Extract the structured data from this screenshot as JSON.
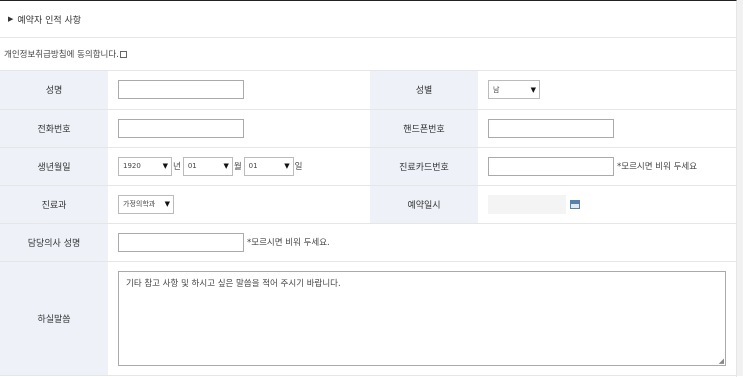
{
  "section": {
    "title": "예약자 인적 사항"
  },
  "consent": {
    "text": "개인정보취급방침에 동의합니다."
  },
  "labels": {
    "name": "성명",
    "gender": "성별",
    "phone": "전화번호",
    "mobile": "핸드폰번호",
    "birth": "생년월일",
    "card": "진료카드번호",
    "dept": "진료과",
    "date": "예약일시",
    "doctor": "담당의사 성명",
    "message": "하실말씀"
  },
  "fields": {
    "name": "",
    "gender": "남",
    "phone": "",
    "mobile": "",
    "birth_year": "1920",
    "birth_month": "01",
    "birth_day": "01",
    "card": "",
    "dept": "가정의학과",
    "date": "",
    "doctor": "",
    "message_placeholder": "기타 참고 사항 및 하시고 싶은 말씀을 적어 주시기 바랍니다."
  },
  "units": {
    "year": "년",
    "month": "월",
    "day": "일"
  },
  "notes": {
    "card": "*모르시면 비워 두세요",
    "doctor": "*모르시면 비워 두세요."
  }
}
